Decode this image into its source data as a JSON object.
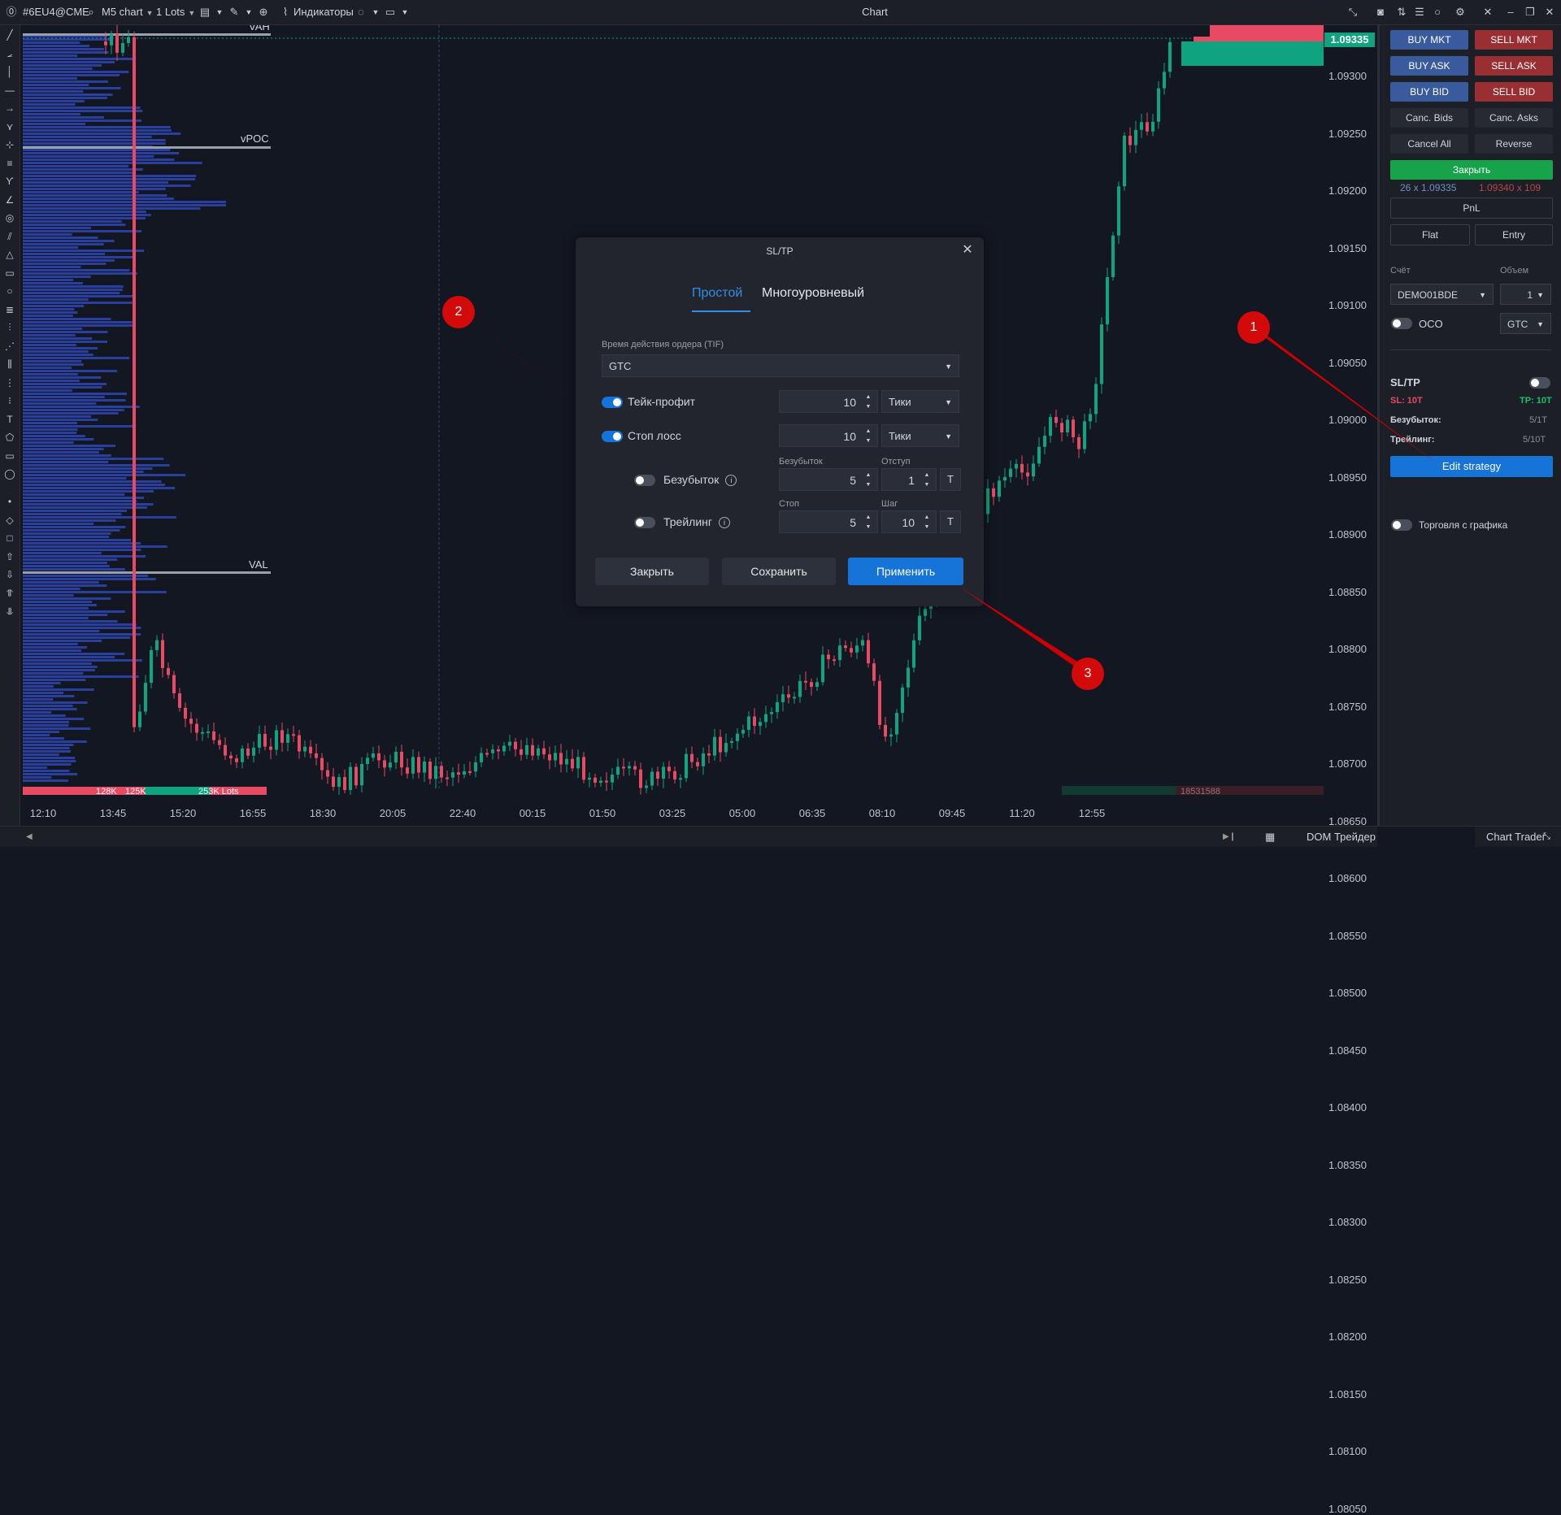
{
  "toolbar": {
    "symbol": "#6EU4@CME",
    "timeframe": "M5 chart",
    "lots": "1 Lots",
    "indicators": "Индикаторы",
    "window_title": "Chart"
  },
  "chart": {
    "vah_label": "VAH",
    "vpoc_label": "vPOC",
    "val_label": "VAL",
    "current_price": "1.09335",
    "price_labels": [
      "1.09300",
      "1.09250",
      "1.09200",
      "1.09150",
      "1.09100",
      "1.09050",
      "1.09000",
      "1.08950",
      "1.08900",
      "1.08850",
      "1.08800",
      "1.08750",
      "1.08700",
      "1.08650",
      "1.08600",
      "1.08550",
      "1.08500",
      "1.08450",
      "1.08400",
      "1.08350",
      "1.08300",
      "1.08250",
      "1.08200",
      "1.08150",
      "1.08100",
      "1.08050"
    ],
    "time_labels": [
      "12:10",
      "13:45",
      "15:20",
      "16:55",
      "18:30",
      "20:05",
      "22:40",
      "00:15",
      "01:50",
      "03:25",
      "05:00",
      "06:35",
      "08:10",
      "09:45",
      "11:20",
      "12:55"
    ],
    "profile_left_volume": "128K",
    "profile_mid_volume": "125K",
    "profile_right_volume": "253K Lots",
    "bottom_volume": "18531588",
    "colors": {
      "bull": "#0fa37f",
      "bear": "#e84a63",
      "profile": "#2d43a8",
      "badge": "#0fa37f"
    }
  },
  "panel": {
    "buy_mkt": "BUY MKT",
    "sell_mkt": "SELL MKT",
    "buy_ask": "BUY ASK",
    "sell_ask": "SELL ASK",
    "buy_bid": "BUY BID",
    "sell_bid": "SELL BID",
    "canc_bids": "Canc. Bids",
    "canc_asks": "Canc. Asks",
    "cancel_all": "Cancel All",
    "reverse": "Reverse",
    "close": "Закрыть",
    "bid_info": "26 x 1.09335",
    "ask_info": "1.09340 x 109",
    "pnl": "PnL",
    "flat": "Flat",
    "entry": "Entry",
    "account_label": "Счёт",
    "volume_label": "Объем",
    "account": "DEMO01BDE",
    "volume": "1",
    "oco": "OCO",
    "tif": "GTC",
    "sltp_title": "SL/TP",
    "sl": "SL: 10T",
    "tp": "TP: 10T",
    "breakeven_label": "Безубыток:",
    "breakeven_value": "5/1T",
    "trailing_label": "Трейлинг:",
    "trailing_value": "5/10T",
    "edit_strategy": "Edit strategy",
    "chart_trading": "Торговля с графика"
  },
  "modal": {
    "title": "SL/TP",
    "tab_simple": "Простой",
    "tab_multilevel": "Многоуровневый",
    "tif_label": "Время действия ордера (TIF)",
    "tif_value": "GTC",
    "take_profit": "Тейк-профит",
    "take_profit_value": "10",
    "take_profit_unit": "Тики",
    "stop_loss": "Стоп лосс",
    "stop_loss_value": "10",
    "stop_loss_unit": "Тики",
    "breakeven_col": "Безубыток",
    "offset_col": "Отступ",
    "breakeven": "Безубыток",
    "breakeven_value": "5",
    "offset_value": "1",
    "stop_col": "Стоп",
    "step_col": "Шаг",
    "trailing": "Трейлинг",
    "trailing_stop_value": "5",
    "trailing_step_value": "10",
    "t_label": "T",
    "close_btn": "Закрыть",
    "save_btn": "Сохранить",
    "apply_btn": "Применить"
  },
  "bottom": {
    "dom_trader": "DOM Трейдер",
    "chart_trader": "Chart Trader"
  },
  "callouts": [
    "1",
    "2",
    "3"
  ]
}
